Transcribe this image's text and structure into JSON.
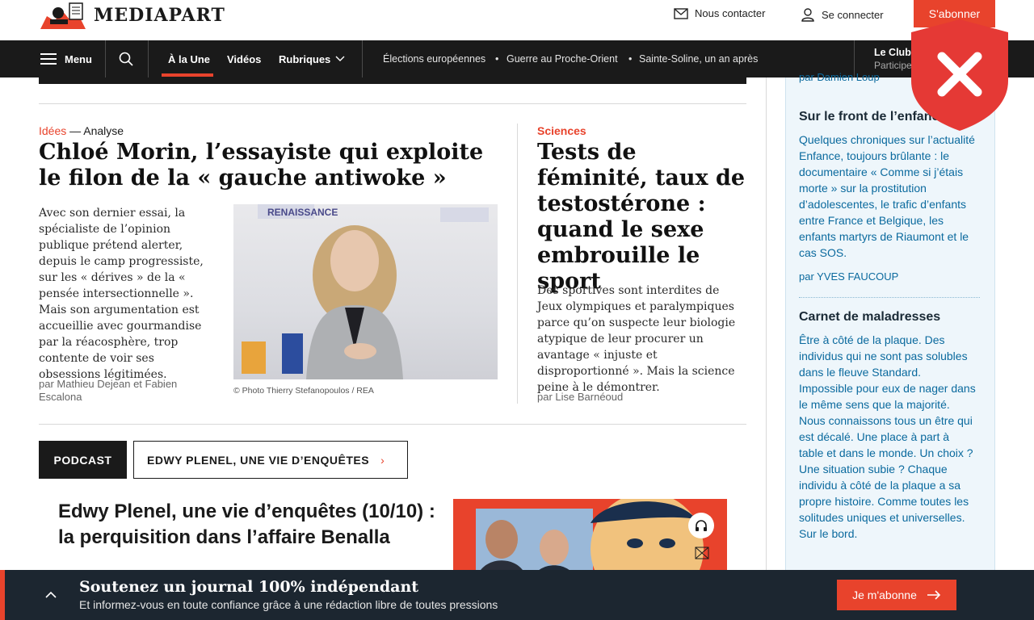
{
  "header": {
    "logo_text": "MEDIAPART",
    "contact_label": "Nous contacter",
    "login_label": "Se connecter",
    "subscribe_label": "S'abonner"
  },
  "nav": {
    "menu_label": "Menu",
    "tabs": [
      {
        "label": "À la Une",
        "active": true
      },
      {
        "label": "Vidéos"
      },
      {
        "label": "Rubriques"
      }
    ],
    "trending": [
      "Élections européennes",
      "Guerre au Proche-Orient",
      "Sainte-Soline, un an après"
    ],
    "club_label": "Le Club",
    "club_sub": "Participe"
  },
  "articles": [
    {
      "category": "Idées",
      "separator": " — ",
      "type": "Analyse",
      "title": "Chloé Morin, l’essayiste qui exploite le filon de la « gauche antiwoke »",
      "lede": "Avec son dernier essai, la spécialiste de l’opinion publique prétend alerter, depuis le camp progressiste, sur les « dérives » de la « pensée intersectionnelle ». Mais son argumentation est accueillie avec gourmandise par la réacosphère, trop contente de voir ses obsessions légitimées.",
      "byline": "par Mathieu Dejean et Fabien Escalona",
      "photo_caption": "© Photo Thierry Stefanopoulos / REA"
    },
    {
      "category": "Sciences",
      "title": "Tests de féminité, taux de testostérone : quand le sexe embrouille le sport",
      "lede": "Des sportives sont interdites de Jeux olympiques et paralympiques parce qu’on suspecte leur biologie atypique de leur procurer un avantage « injuste et disproportionné ». Mais la science peine à le démontrer.",
      "byline": "par Lise Barnéoud"
    }
  ],
  "podcast": {
    "tag": "PODCAST",
    "series": "EDWY PLENEL, UNE VIE D’ENQUÊTES",
    "title": "Edwy Plenel, une vie d’enquêtes (10/10) : la perquisition dans l’affaire Benalla"
  },
  "club": {
    "top_byline": "par Damien Loup",
    "posts": [
      {
        "title": "Sur le front de l’enfance",
        "body": "Quelques chroniques sur l’actualité Enfance, toujours brûlante : le documentaire « Comme si j’étais morte » sur la prostitution d’adolescentes, le trafic d’enfants entre France et Belgique, les enfants martyrs de Riaumont et le cas SOS.",
        "byline": "par YVES FAUCOUP"
      },
      {
        "title": "Carnet de maladresses",
        "body": "Être à côté de la plaque. Des individus qui ne sont pas solubles dans le fleuve Standard. Impossible pour eux de nager dans le même sens que la majorité. Nous connaissons tous un être qui est décalé. Une place à part à table et dans le monde. Un choix ? Une situation subie ? Chaque individu à côté de la plaque a sa propre histoire. Comme toutes les solitudes uniques et universelles. Sur le bord."
      }
    ]
  },
  "banner": {
    "title": "Soutenez un journal 100% indépendant",
    "subtitle": "Et informez-vous en toute confiance grâce à une rédaction libre de toutes pressions",
    "cta": "Je m'abonne"
  },
  "colors": {
    "accent": "#e8432c",
    "dark": "#1a1a1a",
    "club_blue": "#0b6a9e",
    "banner_bg": "#1c2630"
  }
}
